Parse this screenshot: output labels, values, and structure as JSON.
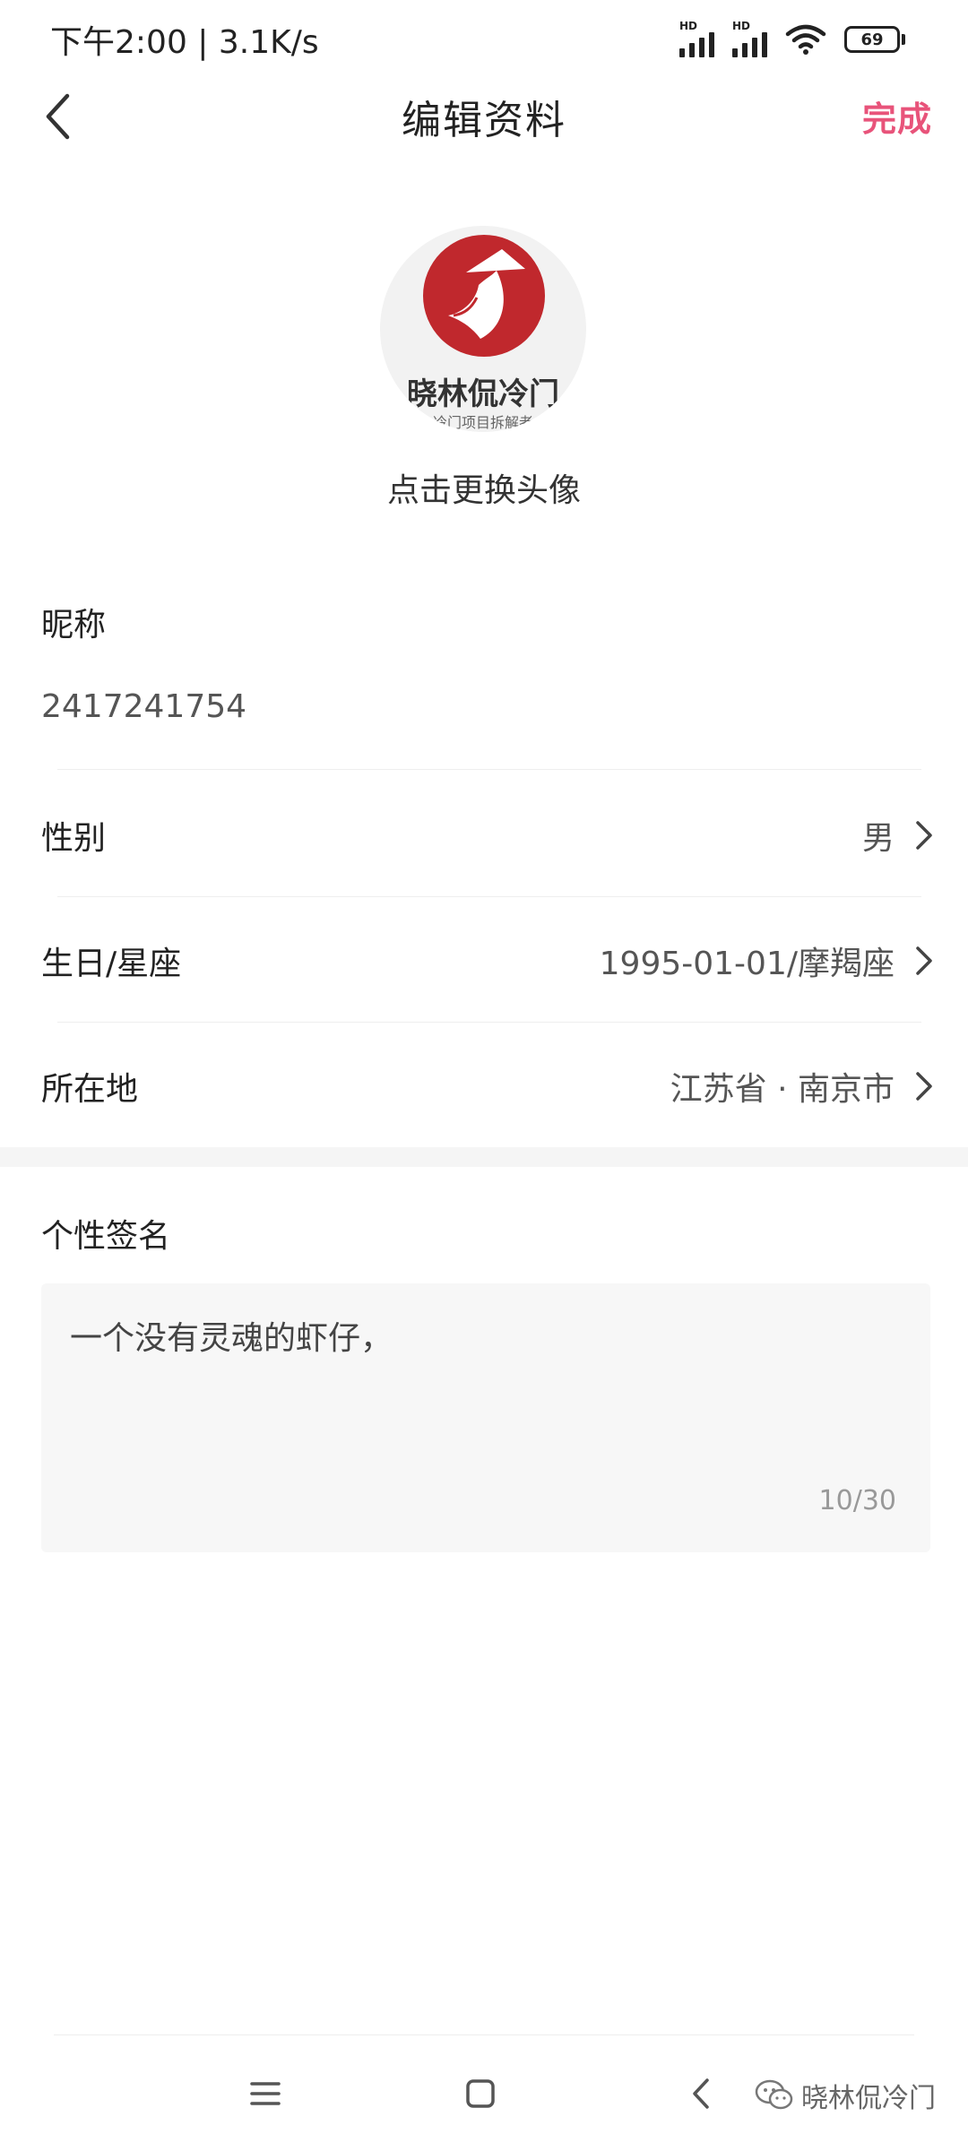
{
  "status_bar": {
    "time": "下午2:00 | 3.1K/s",
    "signal_1_label": "HD",
    "signal_2_label": "HD",
    "battery": "69",
    "icons": [
      "signal-icon",
      "signal-icon",
      "wifi-icon",
      "battery-icon"
    ]
  },
  "nav": {
    "title": "编辑资料",
    "done_label": "完成",
    "back_icon": "chevron-left-icon"
  },
  "avatar": {
    "hint": "点击更换头像",
    "logo_text": "晓林侃冷门",
    "logo_subtext": "冷门项目拆解者"
  },
  "form": {
    "nickname_label": "昵称",
    "nickname_value": "2417241754",
    "gender_label": "性别",
    "gender_value": "男",
    "birthday_label": "生日/星座",
    "birthday_value": "1995-01-01/摩羯座",
    "location_label": "所在地",
    "location_value": "江苏省 · 南京市",
    "signature_label": "个性签名",
    "signature_value": "一个没有灵魂的虾仔，",
    "signature_count": "10/30"
  },
  "watermark": {
    "text": "晓林侃冷门",
    "icon": "wechat-icon"
  },
  "colors": {
    "accent": "#e8537a",
    "logo_red": "#c0282d",
    "input_bg": "#f7f7f7"
  }
}
